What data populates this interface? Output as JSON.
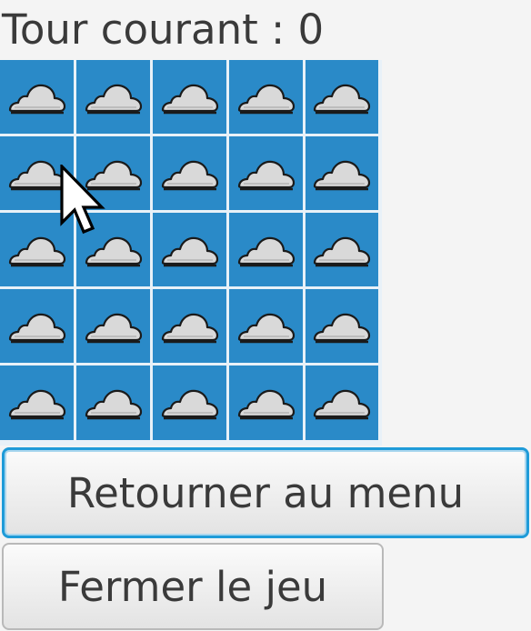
{
  "game": {
    "turn_label": "Tour courant : 0",
    "grid": {
      "rows": 5,
      "cols": 5,
      "cell_icon": "cloud-icon",
      "cell_color": "#2a8ac8"
    }
  },
  "buttons": {
    "menu_label": "Retourner au menu",
    "quit_label": "Fermer le jeu"
  },
  "colors": {
    "focus_border": "#1f9bd8",
    "text": "#3a3a3a",
    "background": "#f4f4f4"
  }
}
